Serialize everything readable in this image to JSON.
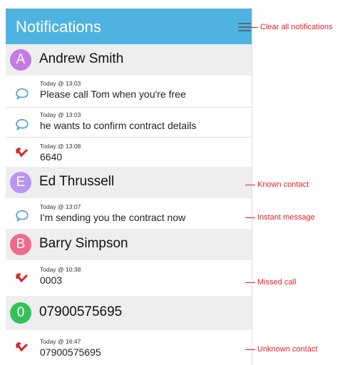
{
  "header": {
    "title": "Notifications"
  },
  "groups": [
    {
      "avatar_letter": "A",
      "avatar_color": "#c37ce6",
      "name": "Andrew Smith",
      "items": [
        {
          "type": "instant-message",
          "time": "Today @ 13:03",
          "text": "Please call Tom when you're free"
        },
        {
          "type": "instant-message",
          "time": "Today @ 13:03",
          "text": "he wants to confirm contract details"
        },
        {
          "type": "missed-call",
          "time": "Today @ 13:08",
          "text": "6640"
        }
      ]
    },
    {
      "avatar_letter": "E",
      "avatar_color": "#b995f0",
      "name": "Ed Thrussell",
      "items": [
        {
          "type": "instant-message",
          "time": "Today @ 13:07",
          "text": "I'm sending you the contract now"
        }
      ]
    },
    {
      "avatar_letter": "B",
      "avatar_color": "#f06b8a",
      "name": "Barry Simpson",
      "items": [
        {
          "type": "missed-call",
          "time": "Today @ 10:38",
          "text": "0003"
        }
      ]
    },
    {
      "avatar_letter": "0",
      "avatar_color": "#33c25a",
      "name": "07900575695",
      "items": [
        {
          "type": "missed-call",
          "time": "Today @ 16:47",
          "text": "07900575695"
        }
      ]
    }
  ],
  "annotations": {
    "clear_all": "Clear all notifications",
    "known_contact": "Known contact",
    "instant_message": "Instant message",
    "missed_call": "Missed call",
    "unknown_contact": "Unknown contact"
  },
  "colors": {
    "header": "#4fb3e2",
    "annotation": "#e31f26",
    "missed_call_icon": "#d9252a",
    "message_icon": "#4a9fd0"
  }
}
